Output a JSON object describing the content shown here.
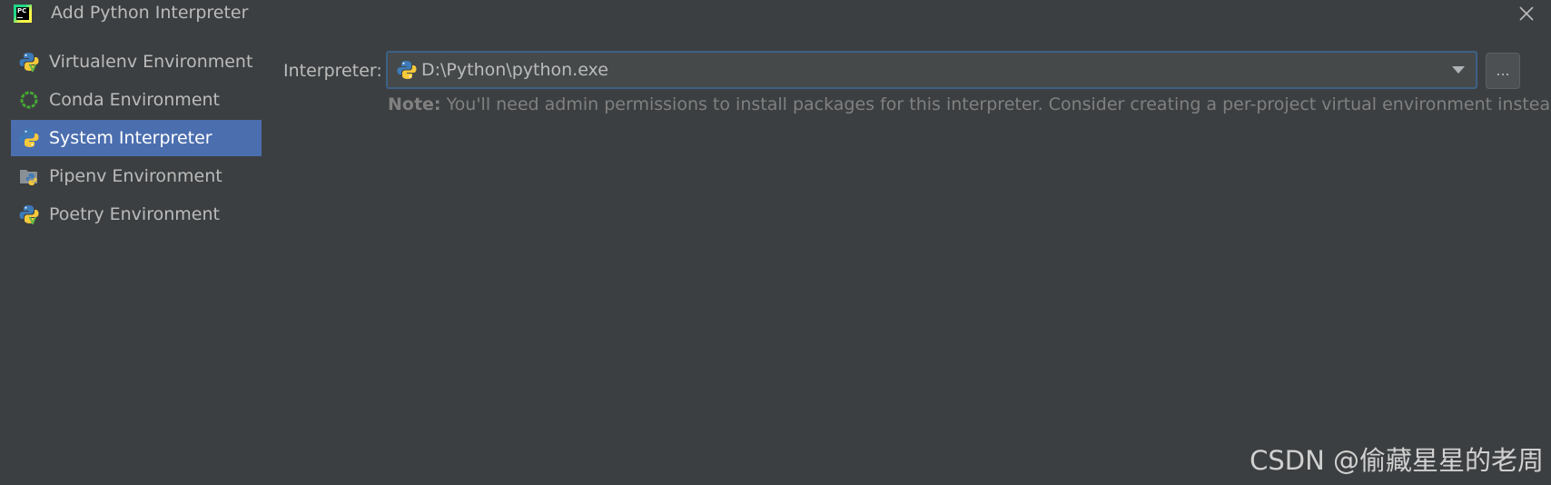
{
  "window": {
    "title": "Add Python Interpreter",
    "logo_text": "PC"
  },
  "sidebar": {
    "items": [
      {
        "label": "Virtualenv Environment",
        "icon": "python-virtualenv-icon"
      },
      {
        "label": "Conda Environment",
        "icon": "conda-icon"
      },
      {
        "label": "System Interpreter",
        "icon": "python-icon",
        "selected": true
      },
      {
        "label": "Pipenv Environment",
        "icon": "pipenv-icon"
      },
      {
        "label": "Poetry Environment",
        "icon": "poetry-icon"
      }
    ]
  },
  "form": {
    "interpreter_label": "Interpreter:",
    "interpreter_value": "D:\\Python\\python.exe",
    "browse_label": "...",
    "note_label": "Note:",
    "note_text": " You'll need admin permissions to install packages for this interpreter. Consider creating a per-project virtual environment instead."
  },
  "watermark": "CSDN @偷藏星星的老周",
  "colors": {
    "background": "#3c3f41",
    "selection": "#4b6eaf",
    "focus_border": "#3d6185",
    "text": "#bbbbbb",
    "muted_text": "#808080"
  }
}
